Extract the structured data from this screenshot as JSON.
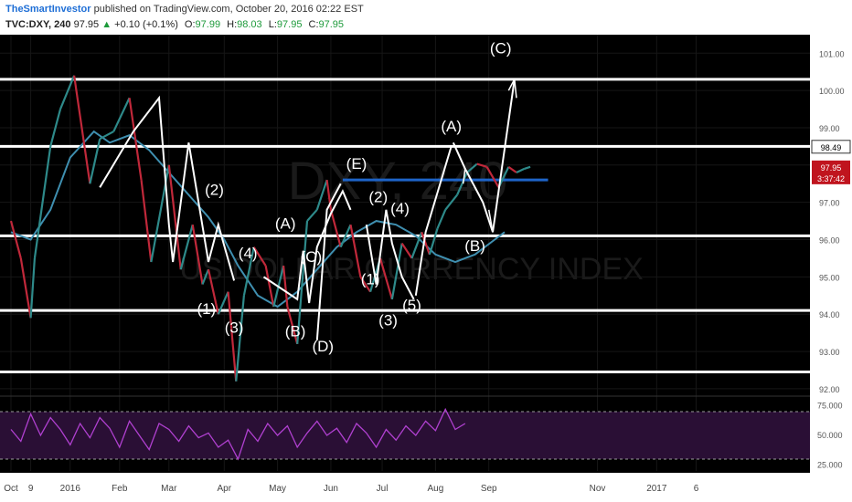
{
  "header": {
    "author": "TheSmartInvestor",
    "published": "published on TradingView.com, October 20, 2016 02:22 EST",
    "symbol": "TVC:DXY, 240",
    "last": "97.95",
    "change": "+0.10 (+0.1%)",
    "o_label": "O:",
    "o_value": "97.99",
    "h_label": "H:",
    "h_value": "98.03",
    "l_label": "L:",
    "l_value": "97.95",
    "c_label": "C:",
    "c_value": "97.95"
  },
  "colors": {
    "background": "#000000",
    "up_candle": "#2e8a8a",
    "down_candle": "#c0283a",
    "ma_line": "#3f8fb0",
    "support_lines": "#ffffff",
    "blue_line": "#1e64c8",
    "rsi_line": "#b040d0",
    "rsi_band": "#2a0f35",
    "price_box": "#c0141e",
    "header_green": "#1d9a3a"
  },
  "chart_data": {
    "type": "line",
    "title": "",
    "watermark_symbol": "DXY, 240",
    "watermark_name": "US DOLLAR CURRENCY INDEX",
    "ylim": [
      91.9,
      101.3
    ],
    "y_ticks": [
      "101.00",
      "100.00",
      "99.00",
      "98.00",
      "97.00",
      "96.00",
      "95.00",
      "94.00",
      "93.00",
      "92.00"
    ],
    "y_tick_values": [
      101,
      100,
      99,
      98,
      97,
      96,
      95,
      94,
      93,
      92
    ],
    "x_ticks": [
      "Oct",
      "9",
      "2016",
      "Feb",
      "Mar",
      "Apr",
      "May",
      "Jun",
      "Jul",
      "Aug",
      "Sep",
      "Nov",
      "2017",
      "6"
    ],
    "x_tick_positions": [
      0.0,
      0.1,
      0.3,
      0.55,
      0.8,
      1.08,
      1.35,
      1.62,
      1.88,
      2.15,
      2.42,
      2.97,
      3.27,
      3.47
    ],
    "price_series": {
      "x": [
        0.0,
        0.05,
        0.1,
        0.12,
        0.2,
        0.25,
        0.32,
        0.4,
        0.45,
        0.52,
        0.6,
        0.66,
        0.71,
        0.8,
        0.86,
        0.92,
        0.97,
        1.0,
        1.05,
        1.1,
        1.14,
        1.18,
        1.23,
        1.29,
        1.33,
        1.38,
        1.4,
        1.45,
        1.5,
        1.55,
        1.6,
        1.62,
        1.67,
        1.72,
        1.77,
        1.82,
        1.87,
        1.93,
        1.98,
        2.03,
        2.08,
        2.12,
        2.16,
        2.2,
        2.26,
        2.31,
        2.36,
        2.41,
        2.47,
        2.52,
        2.56,
        2.6,
        2.63
      ],
      "values": [
        96.5,
        95.5,
        93.9,
        95.5,
        98.5,
        99.5,
        100.4,
        97.5,
        98.7,
        98.9,
        99.8,
        97.6,
        95.4,
        98.0,
        95.2,
        96.4,
        94.8,
        95.2,
        94.0,
        94.6,
        92.2,
        94.5,
        95.8,
        95.3,
        94.2,
        95.3,
        94.2,
        93.2,
        96.5,
        96.8,
        97.6,
        96.8,
        95.8,
        96.4,
        95.0,
        94.6,
        95.5,
        94.4,
        95.9,
        95.5,
        96.2,
        95.6,
        96.3,
        96.8,
        97.2,
        97.8,
        98.03,
        97.95,
        97.4,
        97.95,
        97.8,
        97.9,
        97.95
      ]
    },
    "moving_average": {
      "x": [
        0.0,
        0.1,
        0.2,
        0.3,
        0.42,
        0.5,
        0.6,
        0.7,
        0.8,
        0.9,
        1.0,
        1.08,
        1.15,
        1.25,
        1.35,
        1.45,
        1.55,
        1.65,
        1.75,
        1.85,
        1.95,
        2.05,
        2.15,
        2.25,
        2.35,
        2.45,
        2.5
      ],
      "values": [
        96.2,
        96.0,
        96.8,
        98.2,
        98.9,
        98.6,
        98.8,
        98.4,
        97.8,
        97.2,
        96.6,
        96.0,
        95.3,
        94.5,
        94.2,
        94.6,
        95.2,
        95.8,
        96.2,
        96.5,
        96.4,
        96.1,
        95.6,
        95.4,
        95.6,
        96.0,
        96.2
      ]
    },
    "horizontal_lines": [
      {
        "value": 100.3,
        "color": "#ffffff"
      },
      {
        "value": 98.5,
        "color": "#ffffff"
      },
      {
        "value": 96.1,
        "color": "#ffffff"
      },
      {
        "value": 94.1,
        "color": "#ffffff"
      },
      {
        "value": 92.45,
        "color": "#ffffff"
      },
      {
        "value": 97.6,
        "x_start": 1.68,
        "x_end": 2.72,
        "color": "#1e64c8"
      }
    ],
    "wave_lines": [
      {
        "x": [
          0.45,
          0.62,
          0.75,
          0.8,
          0.82,
          0.9,
          1.0,
          1.05,
          1.13
        ],
        "values": [
          97.4,
          98.9,
          99.8,
          96.4,
          95.4,
          98.6,
          95.4,
          96.4,
          94.9
        ]
      },
      {
        "x": [
          1.28,
          1.45,
          1.48,
          1.51,
          1.55,
          1.62,
          1.68,
          1.72
        ],
        "values": [
          95.0,
          94.4,
          95.7,
          94.3,
          95.8,
          96.7,
          97.3,
          96.8
        ]
      },
      {
        "x": [
          1.55,
          1.6,
          1.67
        ],
        "values": [
          93.3,
          96.8,
          97.5
        ]
      },
      {
        "x": [
          1.8,
          1.85,
          1.9,
          1.93,
          1.98,
          2.04
        ],
        "values": [
          96.4,
          94.8,
          96.8,
          95.9,
          95.0,
          94.4
        ]
      },
      {
        "x": [
          2.05,
          2.1,
          2.23
        ],
        "values": [
          94.5,
          96.2,
          98.5
        ]
      },
      {
        "x": [
          2.24,
          2.3,
          2.39,
          2.44,
          2.55
        ],
        "values": [
          98.6,
          97.9,
          97.0,
          96.2,
          100.3
        ]
      }
    ],
    "wave_labels": [
      {
        "text": "(1)",
        "x": 0.99,
        "value": 94.0
      },
      {
        "text": "(2)",
        "x": 1.03,
        "value": 97.2
      },
      {
        "text": "(3)",
        "x": 1.13,
        "value": 93.5
      },
      {
        "text": "(4)",
        "x": 1.2,
        "value": 95.5
      },
      {
        "text": "(A)",
        "x": 1.39,
        "value": 96.3
      },
      {
        "text": "(B)",
        "x": 1.44,
        "value": 93.4
      },
      {
        "text": "(C)",
        "x": 1.52,
        "value": 95.4
      },
      {
        "text": "(D)",
        "x": 1.58,
        "value": 93.0
      },
      {
        "text": "(E)",
        "x": 1.75,
        "value": 97.9
      },
      {
        "text": "(1)",
        "x": 1.82,
        "value": 94.8
      },
      {
        "text": "(2)",
        "x": 1.86,
        "value": 97.0
      },
      {
        "text": "(3)",
        "x": 1.91,
        "value": 93.7
      },
      {
        "text": "(4)",
        "x": 1.97,
        "value": 96.7
      },
      {
        "text": "(5)",
        "x": 2.03,
        "value": 94.1
      },
      {
        "text": "(A)",
        "x": 2.23,
        "value": 98.9
      },
      {
        "text": "(B)",
        "x": 2.35,
        "value": 95.7
      },
      {
        "text": "(C)",
        "x": 2.48,
        "value": 101.0
      }
    ],
    "price_tags": {
      "level": "98.49",
      "level_value": 98.49,
      "current": "97.95",
      "current_value": 97.95,
      "countdown": "3:37:42"
    },
    "rsi": {
      "ylim": [
        20,
        80
      ],
      "y_ticks": [
        "75.000",
        "50.000",
        "25.000"
      ],
      "y_tick_values": [
        75,
        50,
        25
      ],
      "upper_band": 70,
      "lower_band": 30,
      "x": [
        0.0,
        0.05,
        0.1,
        0.15,
        0.2,
        0.25,
        0.3,
        0.35,
        0.4,
        0.45,
        0.5,
        0.55,
        0.6,
        0.65,
        0.7,
        0.75,
        0.8,
        0.85,
        0.9,
        0.95,
        1.0,
        1.05,
        1.1,
        1.15,
        1.2,
        1.25,
        1.3,
        1.35,
        1.4,
        1.45,
        1.5,
        1.55,
        1.6,
        1.65,
        1.7,
        1.75,
        1.8,
        1.85,
        1.9,
        1.95,
        2.0,
        2.05,
        2.1,
        2.15,
        2.2,
        2.25,
        2.3
      ],
      "values": [
        55,
        45,
        68,
        50,
        65,
        55,
        42,
        60,
        48,
        65,
        56,
        40,
        62,
        50,
        38,
        60,
        55,
        45,
        58,
        48,
        52,
        40,
        46,
        30,
        55,
        45,
        60,
        50,
        58,
        40,
        52,
        62,
        50,
        56,
        44,
        60,
        52,
        40,
        55,
        46,
        58,
        50,
        62,
        54,
        72,
        55,
        60
      ]
    }
  }
}
